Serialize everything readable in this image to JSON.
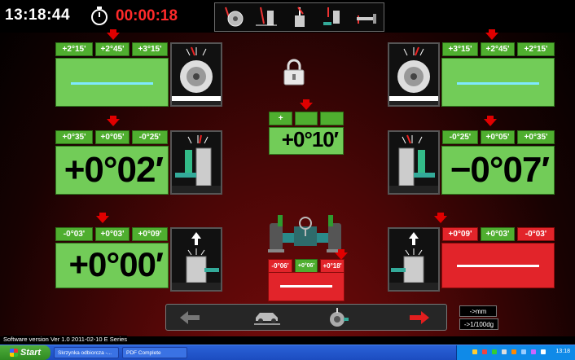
{
  "header": {
    "clock": "13:18:44",
    "timer": "00:00:18",
    "stopwatch_icon": "stopwatch-icon",
    "mode_icons": [
      "camber-mode-icon",
      "caster-mode-icon",
      "kpi-mode-icon",
      "toe-mode-icon",
      "setback-mode-icon"
    ]
  },
  "front_left_camber": {
    "tolerances": [
      "+2°15'",
      "+2°45'",
      "+3°15'"
    ],
    "value": "",
    "status": "in-range"
  },
  "front_right_camber": {
    "tolerances": [
      "+3°15'",
      "+2°45'",
      "+2°15'"
    ],
    "value": "",
    "status": "in-range"
  },
  "front_left_toe": {
    "tolerances": [
      "+0°35'",
      "+0°05'",
      "-0°25'"
    ],
    "value": "+0°02′"
  },
  "front_right_toe": {
    "tolerances": [
      "-0°25'",
      "+0°05'",
      "+0°35'"
    ],
    "value": "−0°07′"
  },
  "total_toe": {
    "tolerances": [
      "+",
      "",
      ""
    ],
    "value": "+0°10′"
  },
  "rear_left": {
    "tolerances": [
      "-0°03'",
      "+0°03'",
      "+0°09'"
    ],
    "value": "+0°00′"
  },
  "rear_right": {
    "tolerances": [
      "+0°09'",
      "+0°03'",
      "-0°03'"
    ],
    "value": "",
    "status": "out-of-range"
  },
  "center_bottom": {
    "tolerances": [
      "-0°06'",
      "+0°06'",
      "+0°18'"
    ],
    "value": "",
    "status": "out-of-range"
  },
  "lock_icon": "padlock-icon",
  "navbar": {
    "items": [
      "back-arrow-icon",
      "car-on-lift-icon",
      "wheel-clamp-icon",
      "next-arrow-icon"
    ]
  },
  "units": {
    "mm": "->mm",
    "deg": "->1/100dg"
  },
  "footer": {
    "version": "Software version Ver 1.0   2011-02-10  E Series"
  },
  "taskbar": {
    "start": "Start",
    "tasks": [
      "Skrzynka odbiorcza -...",
      "PDF Complete"
    ],
    "time": "13:18"
  }
}
